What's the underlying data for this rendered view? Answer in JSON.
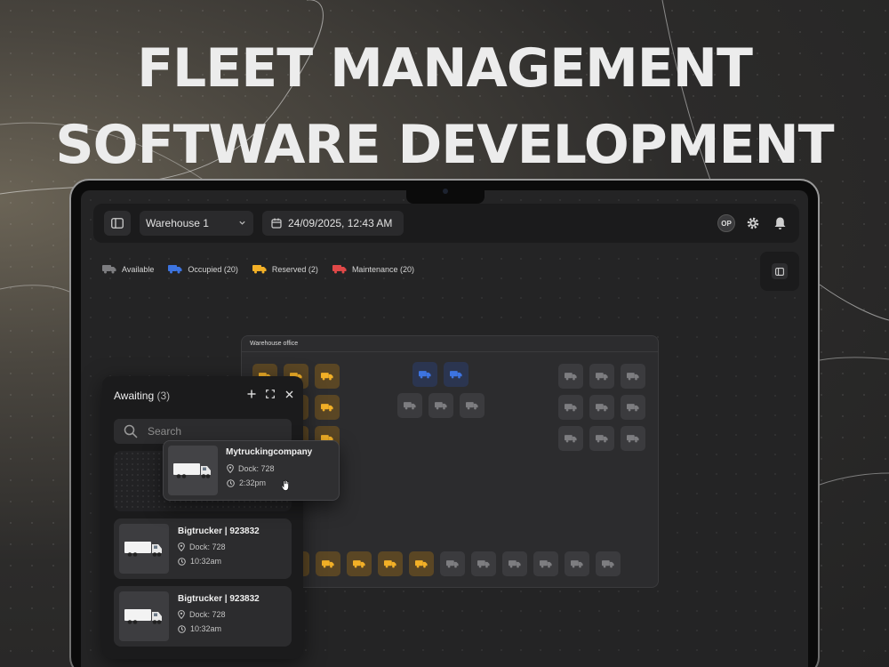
{
  "headline": {
    "line1": "FLEET MANAGEMENT",
    "line2": "SOFTWARE DEVELOPMENT"
  },
  "topbar": {
    "sidebar_icon": "sidebar-toggle-icon",
    "warehouse_select": "Warehouse 1",
    "datetime": "24/09/2025, 12:43 AM",
    "avatar_initials": "OP",
    "icons": [
      "settings-icon",
      "bell-icon"
    ]
  },
  "legend": {
    "available": "Available",
    "occupied": "Occupied (20)",
    "reserved": "Reserved (2)",
    "maintenance": "Maintenance (20)"
  },
  "colors": {
    "available": "#7d7d80",
    "occupied": "#3d74e0",
    "reserved": "#f2b027",
    "maintenance": "#e04848"
  },
  "warehouse": {
    "title": "Warehouse office",
    "slots": {
      "left_block": [
        [
          "reserved",
          "reserved",
          "reserved"
        ],
        [
          "reserved",
          "reserved",
          "reserved"
        ],
        [
          "reserved",
          "reserved",
          "reserved"
        ]
      ],
      "center_top": [
        "occupied",
        "occupied"
      ],
      "center_row": [
        "available",
        "available",
        "available"
      ],
      "right_block": [
        [
          "available",
          "available",
          "available"
        ],
        [
          "available",
          "available",
          "available"
        ],
        [
          "available",
          "available",
          "available"
        ]
      ],
      "bottom_row": [
        "reserved",
        "reserved",
        "reserved",
        "reserved",
        "reserved",
        "available",
        "available",
        "available",
        "available",
        "available",
        "available"
      ]
    }
  },
  "awaiting": {
    "title": "Awaiting",
    "count": "(3)",
    "search_placeholder": "Search",
    "cards": [
      {
        "name": "Bigtrucker | 923832",
        "dock": "Dock: 728",
        "time": "10:32am"
      },
      {
        "name": "Bigtrucker | 923832",
        "dock": "Dock: 728",
        "time": "10:32am"
      }
    ]
  },
  "dragging_card": {
    "name": "Mytruckingcompany",
    "dock": "Dock: 728",
    "time": "2:32pm"
  }
}
